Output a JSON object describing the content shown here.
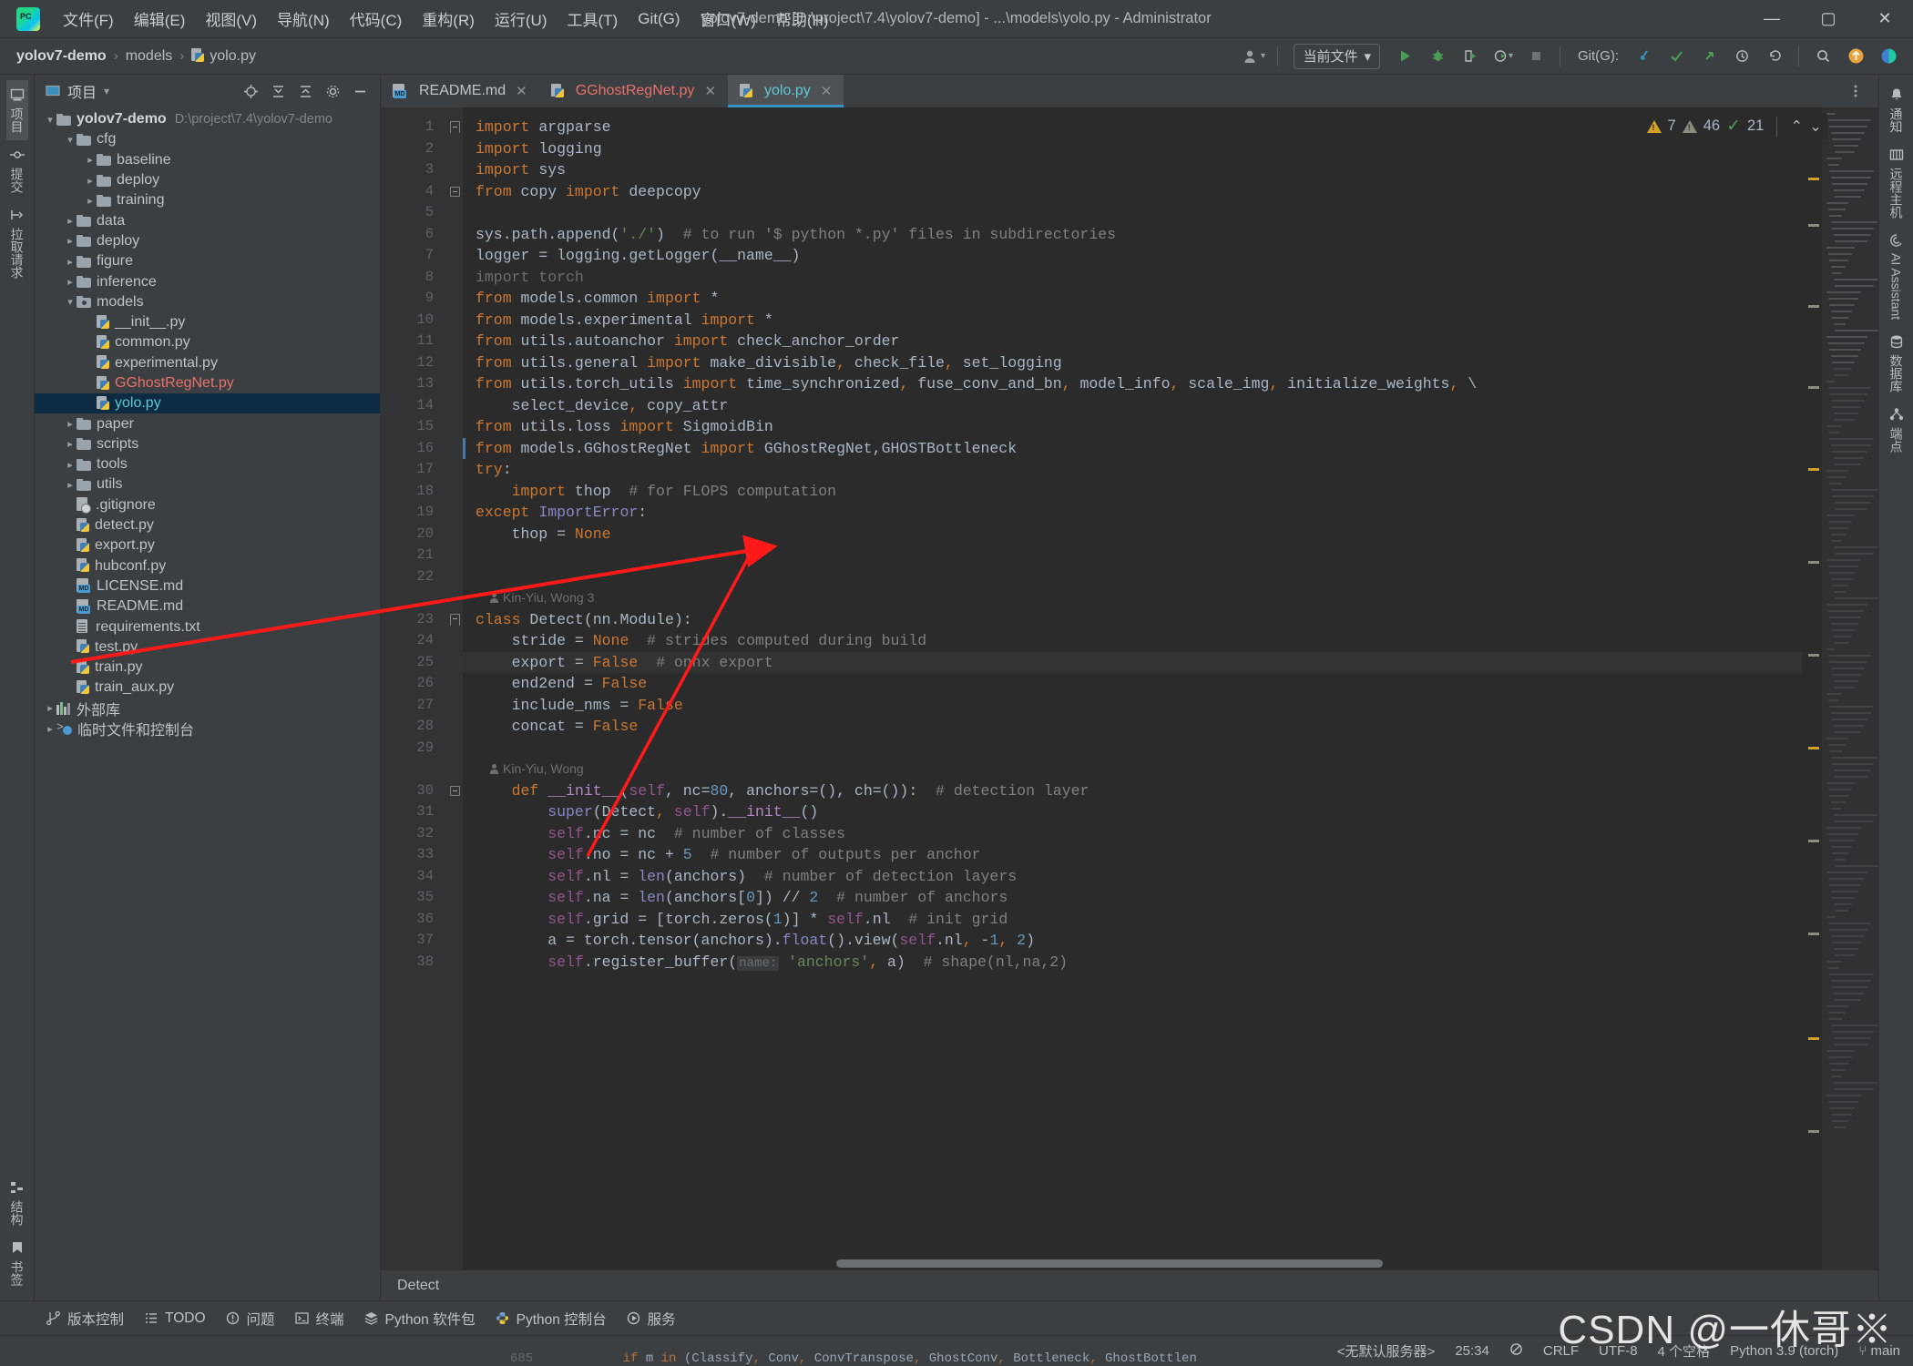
{
  "window": {
    "title": "yolov7-demo [D:\\project\\7.4\\yolov7-demo] - ...\\models\\yolo.py - Administrator",
    "minimize": "—",
    "maximize": "▢",
    "close": "✕"
  },
  "menu": [
    {
      "label": "文件(F)"
    },
    {
      "label": "编辑(E)"
    },
    {
      "label": "视图(V)"
    },
    {
      "label": "导航(N)"
    },
    {
      "label": "代码(C)"
    },
    {
      "label": "重构(R)"
    },
    {
      "label": "运行(U)"
    },
    {
      "label": "工具(T)"
    },
    {
      "label": "Git(G)"
    },
    {
      "label": "窗口(W)"
    },
    {
      "label": "帮助(H)"
    }
  ],
  "breadcrumb": {
    "project": "yolov7-demo",
    "folder": "models",
    "file": "yolo.py",
    "sep": "›"
  },
  "toolbar": {
    "run_config": "当前文件",
    "chevron": "▾",
    "git_label": "Git(G):",
    "run_icon": "run-icon",
    "debug_icon": "debug-icon",
    "coverage_icon": "coverage-icon",
    "profile_icon": "profile-icon",
    "stop_icon": "stop-icon",
    "update_icon": "git-update-icon",
    "commit_icon": "git-commit-icon",
    "push_icon": "git-push-icon",
    "history_icon": "git-history-icon",
    "rollback_icon": "git-rollback-icon",
    "search_icon": "search-everywhere-icon",
    "updates_icon": "updates-icon",
    "ai_icon": "ai-icon"
  },
  "left_strip": [
    {
      "label": "项目",
      "icon": "project-icon",
      "active": true
    },
    {
      "label": "提交",
      "icon": "commit-icon",
      "active": false
    },
    {
      "label": "拉取请求",
      "icon": "pull-request-icon",
      "active": false
    }
  ],
  "left_strip_bottom": [
    {
      "label": "结构",
      "icon": "structure-icon"
    },
    {
      "label": "书签",
      "icon": "bookmarks-icon"
    }
  ],
  "right_strip": [
    {
      "label": "通知",
      "icon": "bell-icon"
    },
    {
      "label": "远程主机",
      "icon": "remote-host-icon"
    },
    {
      "label": "AI Assistant",
      "icon": "ai-assistant-icon"
    },
    {
      "label": "数据库",
      "icon": "database-icon"
    },
    {
      "label": "端点",
      "icon": "endpoints-icon"
    }
  ],
  "project_panel": {
    "title": "项目",
    "chevron": "▾",
    "icons": [
      "locate-icon",
      "expand-all-icon",
      "collapse-all-icon",
      "settings-gear-icon",
      "hide-icon"
    ],
    "tree": [
      {
        "indent": 0,
        "arrow": "v",
        "type": "folder",
        "label": "yolov7-demo",
        "bold": true,
        "path": "D:\\project\\7.4\\yolov7-demo"
      },
      {
        "indent": 1,
        "arrow": "v",
        "type": "folder",
        "label": "cfg"
      },
      {
        "indent": 2,
        "arrow": ">",
        "type": "folder",
        "label": "baseline"
      },
      {
        "indent": 2,
        "arrow": ">",
        "type": "folder",
        "label": "deploy"
      },
      {
        "indent": 2,
        "arrow": ">",
        "type": "folder",
        "label": "training"
      },
      {
        "indent": 1,
        "arrow": ">",
        "type": "folder",
        "label": "data"
      },
      {
        "indent": 1,
        "arrow": ">",
        "type": "folder",
        "label": "deploy"
      },
      {
        "indent": 1,
        "arrow": ">",
        "type": "folder",
        "label": "figure"
      },
      {
        "indent": 1,
        "arrow": ">",
        "type": "folder",
        "label": "inference"
      },
      {
        "indent": 1,
        "arrow": "v",
        "type": "folder-src",
        "label": "models"
      },
      {
        "indent": 2,
        "arrow": "",
        "type": "py",
        "label": "__init__.py"
      },
      {
        "indent": 2,
        "arrow": "",
        "type": "py",
        "label": "common.py"
      },
      {
        "indent": 2,
        "arrow": "",
        "type": "py",
        "label": "experimental.py"
      },
      {
        "indent": 2,
        "arrow": "",
        "type": "py",
        "label": "GGhostRegNet.py",
        "color": "red"
      },
      {
        "indent": 2,
        "arrow": "",
        "type": "py",
        "label": "yolo.py",
        "selected": true
      },
      {
        "indent": 1,
        "arrow": ">",
        "type": "folder",
        "label": "paper"
      },
      {
        "indent": 1,
        "arrow": ">",
        "type": "folder",
        "label": "scripts"
      },
      {
        "indent": 1,
        "arrow": ">",
        "type": "folder",
        "label": "tools"
      },
      {
        "indent": 1,
        "arrow": ">",
        "type": "folder",
        "label": "utils"
      },
      {
        "indent": 1,
        "arrow": "",
        "type": "gitignore",
        "label": ".gitignore"
      },
      {
        "indent": 1,
        "arrow": "",
        "type": "py",
        "label": "detect.py"
      },
      {
        "indent": 1,
        "arrow": "",
        "type": "py",
        "label": "export.py"
      },
      {
        "indent": 1,
        "arrow": "",
        "type": "py",
        "label": "hubconf.py"
      },
      {
        "indent": 1,
        "arrow": "",
        "type": "md",
        "label": "LICENSE.md"
      },
      {
        "indent": 1,
        "arrow": "",
        "type": "md",
        "label": "README.md"
      },
      {
        "indent": 1,
        "arrow": "",
        "type": "txt",
        "label": "requirements.txt"
      },
      {
        "indent": 1,
        "arrow": "",
        "type": "py",
        "label": "test.py"
      },
      {
        "indent": 1,
        "arrow": "",
        "type": "py",
        "label": "train.py"
      },
      {
        "indent": 1,
        "arrow": "",
        "type": "py",
        "label": "train_aux.py"
      },
      {
        "indent": 0,
        "arrow": ">",
        "type": "lib",
        "label": "外部库"
      },
      {
        "indent": 0,
        "arrow": ">",
        "type": "scratch",
        "label": "临时文件和控制台"
      }
    ]
  },
  "tabs": [
    {
      "label": "README.md",
      "type": "md",
      "color": "default",
      "active": false,
      "close": "✕"
    },
    {
      "label": "GGhostRegNet.py",
      "type": "py",
      "color": "red",
      "active": false,
      "close": "✕"
    },
    {
      "label": "yolo.py",
      "type": "py",
      "color": "cyan",
      "active": true,
      "close": "✕"
    }
  ],
  "inspections": {
    "warnings": "7",
    "weak_warnings": "46",
    "checks": "21",
    "up": "⌃",
    "down": "⌄"
  },
  "editor": {
    "highlighted_line": 25,
    "breadcrumb": "Detect",
    "lines": [
      {
        "n": 1,
        "fold": "start",
        "html": "<span class=\"kw\">import</span> argparse"
      },
      {
        "n": 2,
        "html": "<span class=\"kw\">import</span> logging"
      },
      {
        "n": 3,
        "html": "<span class=\"kw\">import</span> sys"
      },
      {
        "n": 4,
        "fold": "end",
        "html": "<span class=\"kw\">from</span> copy <span class=\"kw\">import</span> deepcopy"
      },
      {
        "n": 5,
        "html": ""
      },
      {
        "n": 6,
        "html": "sys.path.append(<span class=\"st\">'./'</span>)  <span class=\"cm\"># to run '$ python *.py' files in subdirectories</span>"
      },
      {
        "n": 7,
        "html": "logger = logging.getLogger(__name__)"
      },
      {
        "n": 8,
        "html": "<span class=\"dim\">import torch</span>"
      },
      {
        "n": 9,
        "html": "<span class=\"kw\">from</span> models.common <span class=\"kw\">import</span> *"
      },
      {
        "n": 10,
        "html": "<span class=\"kw\">from</span> models.experimental <span class=\"kw\">import</span> *"
      },
      {
        "n": 11,
        "html": "<span class=\"kw\">from</span> utils.autoanchor <span class=\"kw\">import</span> check_anchor_order"
      },
      {
        "n": 12,
        "html": "<span class=\"kw\">from</span> utils.general <span class=\"kw\">import</span> make_divisible<span class=\"kw\">,</span> check_file<span class=\"kw\">,</span> set_logging"
      },
      {
        "n": 13,
        "html": "<span class=\"kw\">from</span> utils.torch_utils <span class=\"kw\">import</span> time_synchronized<span class=\"kw\">,</span> fuse_conv_and_bn<span class=\"kw\">,</span> model_info<span class=\"kw\">,</span> scale_img<span class=\"kw\">,</span> initialize_weights<span class=\"kw\">,</span> \\"
      },
      {
        "n": 14,
        "html": "    select_device<span class=\"kw\">,</span> copy_attr"
      },
      {
        "n": 15,
        "html": "<span class=\"kw\">from</span> utils.loss <span class=\"kw\">import</span> SigmoidBin"
      },
      {
        "n": 16,
        "mark": true,
        "html": "<span class=\"kw\">from</span> models.GGhostRegNet <span class=\"kw\">import</span> GGhostRegNet,GHOSTBottleneck"
      },
      {
        "n": 17,
        "html": "<span class=\"kw\">try</span>:"
      },
      {
        "n": 18,
        "html": "    <span class=\"kw\">import</span> thop  <span class=\"cm\"># for FLOPS computation</span>"
      },
      {
        "n": 19,
        "html": "<span class=\"kw\">except</span> <span class=\"builtin\">ImportError</span>:"
      },
      {
        "n": 20,
        "html": "    thop = <span class=\"kw\">None</span>"
      },
      {
        "n": 21,
        "html": ""
      },
      {
        "n": 22,
        "html": ""
      },
      {
        "n": null,
        "annot": "Kin-Yiu, Wong 3"
      },
      {
        "n": 23,
        "fold": "start",
        "html": "<span class=\"kw\">class</span> <span class=\"cls\">Detect</span>(nn.Module):"
      },
      {
        "n": 24,
        "html": "    stride = <span class=\"kw\">None</span>  <span class=\"cm\"># strides computed during build</span>"
      },
      {
        "n": 25,
        "html": "    export = <span class=\"kw\">False</span>  <span class=\"cm\"># onnx export</span>"
      },
      {
        "n": 26,
        "html": "    end2end = <span class=\"kw\">False</span>"
      },
      {
        "n": 27,
        "html": "    include_nms = <span class=\"kw\">False</span>"
      },
      {
        "n": 28,
        "html": "    concat = <span class=\"kw\">False</span>"
      },
      {
        "n": 29,
        "html": ""
      },
      {
        "n": null,
        "annot": "Kin-Yiu, Wong"
      },
      {
        "n": 30,
        "fold": "end",
        "html": "    <span class=\"kw\">def</span> <span class=\"magenta\">__init__</span>(<span class=\"self\">self</span>, nc=<span class=\"num\">80</span>, anchors=(), ch=()):  <span class=\"cm\"># detection layer</span>"
      },
      {
        "n": 31,
        "html": "        <span class=\"builtin\">super</span>(Detect<span class=\"kw\">,</span> <span class=\"self\">self</span>).<span class=\"magenta\">__init__</span>()"
      },
      {
        "n": 32,
        "html": "        <span class=\"self\">self</span>.nc = nc  <span class=\"cm\"># number of classes</span>"
      },
      {
        "n": 33,
        "html": "        <span class=\"self\">self</span>.no = nc + <span class=\"num\">5</span>  <span class=\"cm\"># number of outputs per anchor</span>"
      },
      {
        "n": 34,
        "html": "        <span class=\"self\">self</span>.nl = <span class=\"builtin\">len</span>(anchors)  <span class=\"cm\"># number of detection layers</span>"
      },
      {
        "n": 35,
        "html": "        <span class=\"self\">self</span>.na = <span class=\"builtin\">len</span>(anchors[<span class=\"num\">0</span>]) // <span class=\"num\">2</span>  <span class=\"cm\"># number of anchors</span>"
      },
      {
        "n": 36,
        "html": "        <span class=\"self\">self</span>.grid = [torch.zeros(<span class=\"num\">1</span>)] * <span class=\"self\">self</span>.nl  <span class=\"cm\"># init grid</span>"
      },
      {
        "n": 37,
        "html": "        a = torch.tensor(anchors).<span class=\"builtin\">float</span>().view(<span class=\"self\">self</span>.nl<span class=\"kw\">,</span> -<span class=\"num\">1</span><span class=\"kw\">,</span> <span class=\"num\">2</span>)"
      },
      {
        "n": 38,
        "html": "        <span class=\"self\">self</span>.register_buffer(<span class=\"hint\">name:</span> <span class=\"st\">'anchors'</span><span class=\"kw\">,</span> a)  <span class=\"cm\"># shape(nl,na,2)</span>"
      }
    ]
  },
  "bottom_tools": [
    {
      "label": "版本控制",
      "icon": "version-control-icon"
    },
    {
      "label": "TODO",
      "icon": "todo-icon"
    },
    {
      "label": "问题",
      "icon": "problems-icon"
    },
    {
      "label": "终端",
      "icon": "terminal-icon"
    },
    {
      "label": "Python 软件包",
      "icon": "python-packages-icon"
    },
    {
      "label": "Python 控制台",
      "icon": "python-console-icon"
    },
    {
      "label": "服务",
      "icon": "services-icon"
    }
  ],
  "status_bar": {
    "server": "<无默认服务器>",
    "caret": "25:34",
    "indent_read_only": "read-only-icon",
    "line_sep": "CRLF",
    "encoding": "UTF-8",
    "indent": "4 个空格",
    "interpreter": "Python 3.9 (torch)",
    "branch": "main",
    "branch_icon": "git-branch-icon"
  },
  "bleed_line": {
    "n": "685",
    "html": "<span class=\"kw\">if</span> m <span class=\"kw\">in</span> (<span class=\"cls\">Classify</span><span class=\"kw\">,</span> <span class=\"cls\">Conv</span><span class=\"kw\">,</span> <span class=\"cls\">ConvTranspose</span><span class=\"kw\">,</span> <span class=\"cls\">GhostConv</span><span class=\"kw\">,</span> <span class=\"cls\">Bottleneck</span><span class=\"kw\">,</span> <span class=\"cls\">GhostBottlen</span>"
  },
  "watermark": "CSDN @一休哥※",
  "colors": {
    "accent": "#3592c4",
    "selection": "#0d2b42",
    "error_red": "#e8716b",
    "keyword_orange": "#cc7832",
    "string_green": "#6a8759",
    "number_blue": "#6897bb",
    "annotation_red": "#ff0000"
  }
}
